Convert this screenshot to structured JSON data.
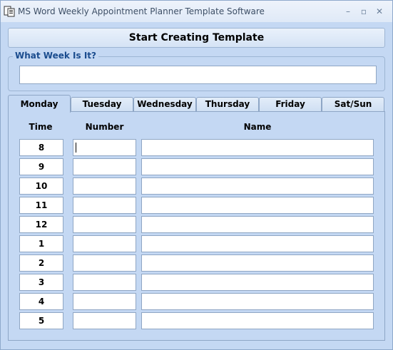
{
  "window": {
    "title": "MS Word Weekly Appointment Planner Template Software",
    "controls": {
      "minimize": "–",
      "maximize": "▫",
      "close": "✕"
    }
  },
  "toolbar": {
    "start_label": "Start Creating Template"
  },
  "week": {
    "legend": "What Week Is It?",
    "value": ""
  },
  "tabs": [
    {
      "label": "Monday",
      "active": true
    },
    {
      "label": "Tuesday",
      "active": false
    },
    {
      "label": "Wednesday",
      "active": false
    },
    {
      "label": "Thursday",
      "active": false
    },
    {
      "label": "Friday",
      "active": false
    },
    {
      "label": "Sat/Sun",
      "active": false
    }
  ],
  "table": {
    "headers": {
      "time": "Time",
      "number": "Number",
      "name": "Name"
    },
    "rows": [
      {
        "time": "8",
        "number": "",
        "name": ""
      },
      {
        "time": "9",
        "number": "",
        "name": ""
      },
      {
        "time": "10",
        "number": "",
        "name": ""
      },
      {
        "time": "11",
        "number": "",
        "name": ""
      },
      {
        "time": "12",
        "number": "",
        "name": ""
      },
      {
        "time": "1",
        "number": "",
        "name": ""
      },
      {
        "time": "2",
        "number": "",
        "name": ""
      },
      {
        "time": "3",
        "number": "",
        "name": ""
      },
      {
        "time": "4",
        "number": "",
        "name": ""
      },
      {
        "time": "5",
        "number": "",
        "name": ""
      }
    ]
  }
}
